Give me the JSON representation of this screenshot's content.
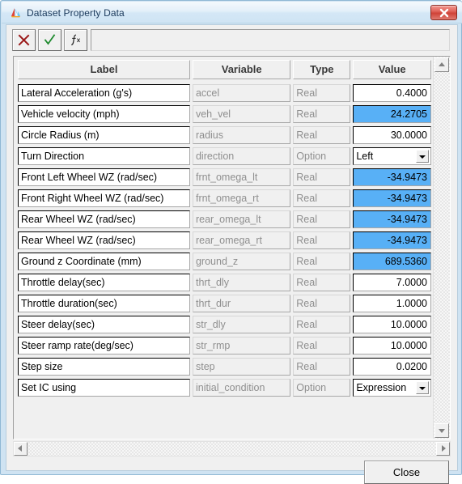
{
  "window": {
    "title": "Dataset Property Data",
    "icon": "app-triangle-icon",
    "close_icon": "close-icon",
    "accent_blue": "#cfe3f2",
    "highlight_blue": "#58b0f6"
  },
  "toolbar": {
    "cancel_icon": "red-x-icon",
    "accept_icon": "green-check-icon",
    "function_icon": "fx-function-icon",
    "expression_field_value": "",
    "expression_field_placeholder": ""
  },
  "table": {
    "columns": [
      "Label",
      "Variable",
      "Type",
      "Value"
    ],
    "rows": [
      {
        "label": "Lateral Acceleration (g's)",
        "variable": "accel",
        "type": "Real",
        "value": "0.4000",
        "highlight": false,
        "control": "text"
      },
      {
        "label": "Vehicle velocity (mph)",
        "variable": "veh_vel",
        "type": "Real",
        "value": "24.2705",
        "highlight": true,
        "control": "text"
      },
      {
        "label": "Circle Radius (m)",
        "variable": "radius",
        "type": "Real",
        "value": "30.0000",
        "highlight": false,
        "control": "text"
      },
      {
        "label": "Turn Direction",
        "variable": "direction",
        "type": "Option",
        "value": "Left",
        "highlight": false,
        "control": "combo"
      },
      {
        "label": "Front Left Wheel WZ (rad/sec)",
        "variable": "frnt_omega_lt",
        "type": "Real",
        "value": "-34.9473",
        "highlight": true,
        "control": "text"
      },
      {
        "label": "Front Right Wheel WZ (rad/sec)",
        "variable": "frnt_omega_rt",
        "type": "Real",
        "value": "-34.9473",
        "highlight": true,
        "control": "text"
      },
      {
        "label": "Rear Wheel WZ (rad/sec)",
        "variable": "rear_omega_lt",
        "type": "Real",
        "value": "-34.9473",
        "highlight": true,
        "control": "text"
      },
      {
        "label": "Rear Wheel WZ (rad/sec)",
        "variable": "rear_omega_rt",
        "type": "Real",
        "value": "-34.9473",
        "highlight": true,
        "control": "text"
      },
      {
        "label": "Ground z Coordinate (mm)",
        "variable": "ground_z",
        "type": "Real",
        "value": "689.5360",
        "highlight": true,
        "control": "text"
      },
      {
        "label": "Throttle delay(sec)",
        "variable": "thrt_dly",
        "type": "Real",
        "value": "7.0000",
        "highlight": false,
        "control": "text"
      },
      {
        "label": "Throttle duration(sec)",
        "variable": "thrt_dur",
        "type": "Real",
        "value": "1.0000",
        "highlight": false,
        "control": "text"
      },
      {
        "label": "Steer delay(sec)",
        "variable": "str_dly",
        "type": "Real",
        "value": "10.0000",
        "highlight": false,
        "control": "text"
      },
      {
        "label": "Steer ramp rate(deg/sec)",
        "variable": "str_rmp",
        "type": "Real",
        "value": "10.0000",
        "highlight": false,
        "control": "text"
      },
      {
        "label": "Step size",
        "variable": "step",
        "type": "Real",
        "value": "0.0200",
        "highlight": false,
        "control": "text"
      },
      {
        "label": "Set IC using",
        "variable": "initial_condition",
        "type": "Option",
        "value": "Expression",
        "highlight": false,
        "control": "combo"
      }
    ]
  },
  "scrollbars": {
    "vertical_up_icon": "scroll-up-arrow-icon",
    "vertical_down_icon": "scroll-down-arrow-icon",
    "horizontal_left_icon": "scroll-left-arrow-icon",
    "horizontal_right_icon": "scroll-right-arrow-icon"
  },
  "footer": {
    "close_label": "Close"
  }
}
